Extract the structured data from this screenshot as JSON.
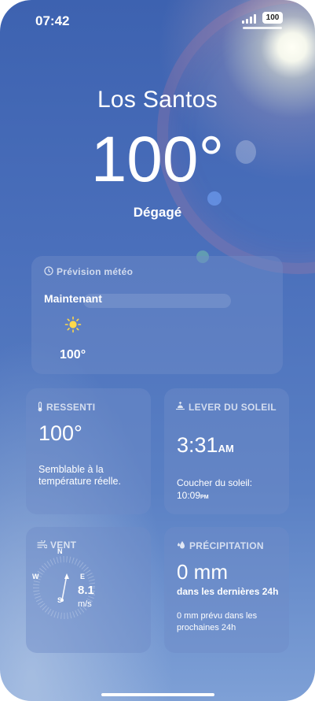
{
  "status_bar": {
    "time": "07:42",
    "battery": "100"
  },
  "weather": {
    "city": "Los Santos",
    "temperature": "100°",
    "condition": "Dégagé"
  },
  "forecast": {
    "title": "Prévision météo",
    "label": "Maintenant",
    "icon": "sun-icon",
    "temperature": "100°"
  },
  "feels_like": {
    "title": "RESSENTI",
    "value": "100°",
    "description": "Semblable à la température réelle."
  },
  "sunrise": {
    "title": "LEVER DU SOLEIL",
    "time": "3:31",
    "ampm": "AM",
    "sunset_label": "Coucher du soleil:",
    "sunset_time": "10:09",
    "sunset_ampm": "PM"
  },
  "wind": {
    "title": "VENT",
    "north": "N",
    "east": "E",
    "south": "S",
    "west": "W",
    "speed": "8.1",
    "unit": "m/s"
  },
  "precipitation": {
    "title": "PRÉCIPITATION",
    "amount": "0 mm",
    "period": "dans les dernières 24h",
    "forecast_text": "0 mm prévu dans les prochaines 24h"
  },
  "colors": {
    "background_top": "#3d62b0",
    "background_bottom": "#7ea0d6",
    "sun": "#ffd84a"
  }
}
